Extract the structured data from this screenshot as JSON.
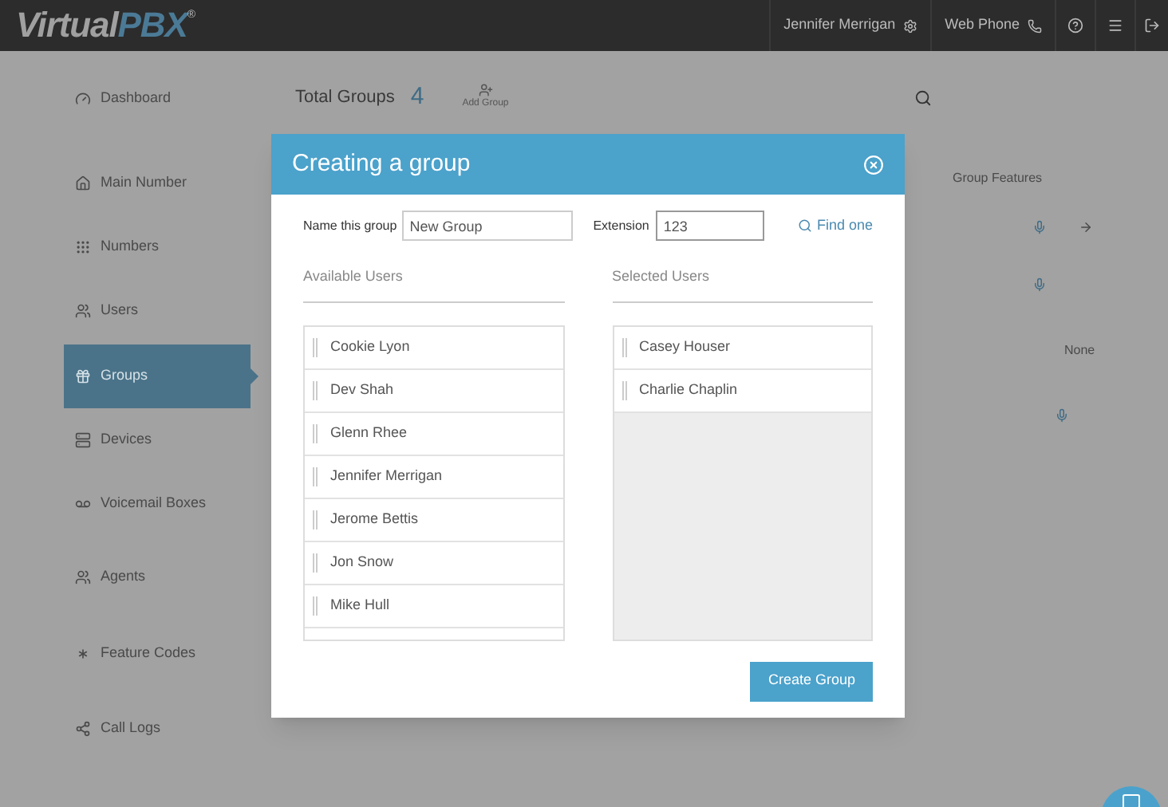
{
  "header": {
    "logo_primary": "Virtual",
    "logo_secondary": "PBX",
    "logo_mark": "®",
    "user": "Jennifer Merrigan",
    "web_phone": "Web Phone"
  },
  "sidebar": {
    "items": [
      {
        "label": "Dashboard",
        "kind": "dashboard",
        "selected": false
      },
      {
        "label": "Main Number",
        "kind": "home",
        "selected": false
      },
      {
        "label": "Numbers",
        "kind": "grid",
        "selected": false
      },
      {
        "label": "Users",
        "kind": "users",
        "selected": false
      },
      {
        "label": "Groups",
        "kind": "groups",
        "selected": true
      },
      {
        "label": "Devices",
        "kind": "devices",
        "selected": false
      },
      {
        "label": "Voicemail Boxes",
        "kind": "voicemail",
        "selected": false
      },
      {
        "label": "Agents",
        "kind": "users",
        "selected": false
      },
      {
        "label": "Feature Codes",
        "kind": "asterisk",
        "selected": false
      },
      {
        "label": "Call Logs",
        "kind": "logs",
        "selected": false
      }
    ]
  },
  "content": {
    "title": "Total Groups",
    "count": "4",
    "add_group": "Add Group",
    "column_heading": "Group Features",
    "feature_text": "None"
  },
  "modal": {
    "title": "Creating a group",
    "name_label": "Name this group",
    "name_value": "New Group",
    "extension_label": "Extension",
    "extension_value": "123",
    "find_link": "Find one",
    "available_heading": "Available Users",
    "selected_heading": "Selected Users",
    "available_users": [
      "Cookie Lyon",
      "Dev Shah",
      "Glenn Rhee",
      "Jennifer Merrigan",
      "Jerome Bettis",
      "Jon Snow",
      "Mike Hull"
    ],
    "selected_users": [
      "Casey Houser",
      "Charlie Chaplin"
    ],
    "create_button": "Create Group"
  }
}
